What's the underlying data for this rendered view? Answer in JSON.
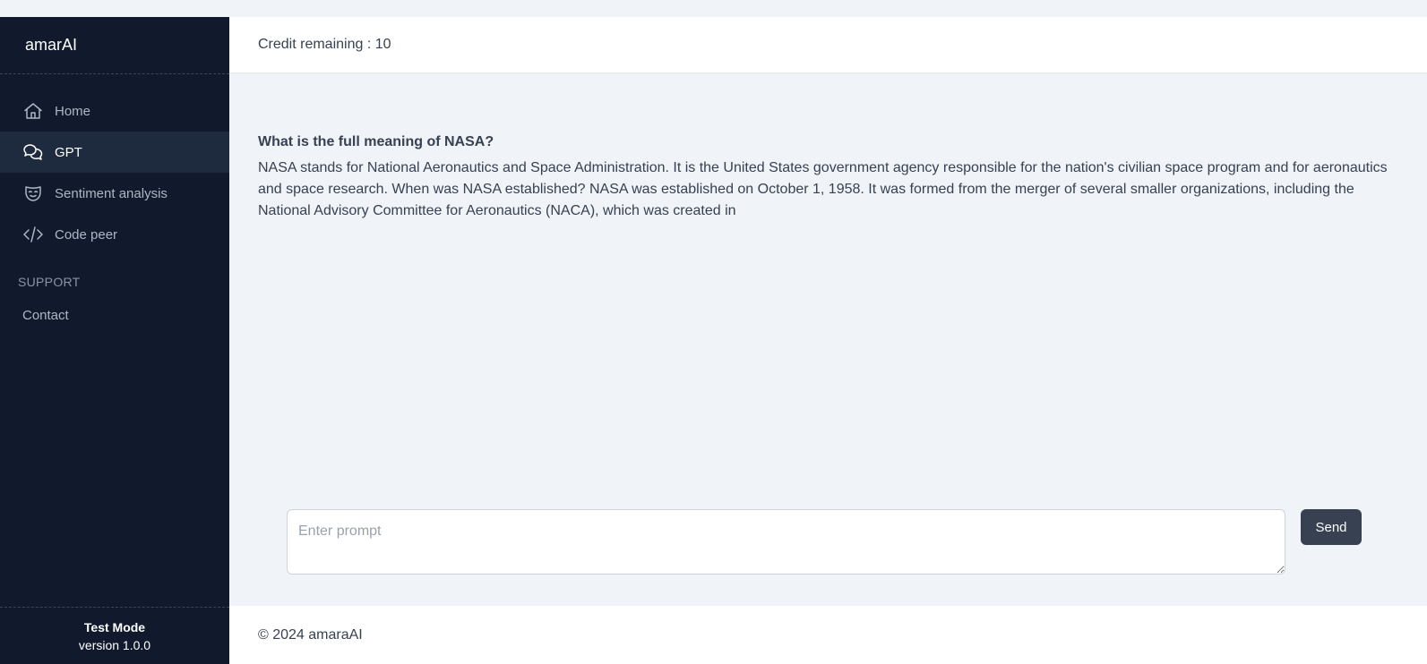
{
  "sidebar": {
    "brand": "amarAI",
    "items": [
      {
        "label": "Home",
        "icon": "home-icon"
      },
      {
        "label": "GPT",
        "icon": "chat-icon",
        "active": true
      },
      {
        "label": "Sentiment analysis",
        "icon": "mask-icon"
      },
      {
        "label": "Code peer",
        "icon": "code-icon"
      }
    ],
    "section_label": "SUPPORT",
    "contact_label": "Contact",
    "footer": {
      "mode": "Test Mode",
      "version": "version 1.0.0"
    }
  },
  "topbar": {
    "credit_text": "Credit remaining : 10"
  },
  "main": {
    "question": "What is the full meaning of NASA?",
    "answer": "NASA stands for National Aeronautics and Space Administration. It is the United States government agency responsible for the nation's civilian space program and for aeronautics and space research. When was NASA established? NASA was established on October 1, 1958. It was formed from the merger of several smaller organizations, including the National Advisory Committee for Aeronautics (NACA), which was created in"
  },
  "prompt": {
    "placeholder": "Enter prompt",
    "value": ""
  },
  "send_label": "Send",
  "footer": {
    "copyright": "© 2024 amaraAI"
  },
  "colors": {
    "sidebar_bg": "#111a2c",
    "active_item_bg": "#1e2a3d",
    "page_bg": "#f0f3f8",
    "button_bg": "#374151"
  }
}
